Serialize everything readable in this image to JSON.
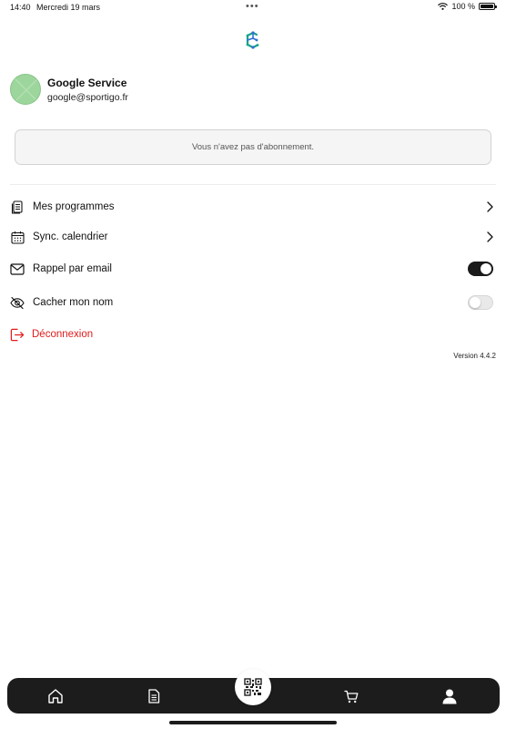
{
  "status_bar": {
    "time": "14:40",
    "date": "Mercredi 19 mars",
    "dots": "•••",
    "battery": "100 %",
    "icons": [
      "wifi-icon",
      "battery-icon"
    ]
  },
  "logo": {
    "icon": "app-logo-icon",
    "color": "#1aa38a"
  },
  "profile": {
    "name": "Google Service",
    "email": "google@sportigo.fr",
    "avatar_color": "#9dd69d"
  },
  "subscription": {
    "message": "Vous n'avez pas d'abonnement."
  },
  "menu": {
    "programmes": {
      "label": "Mes programmes",
      "icon": "document-list-icon"
    },
    "calendar": {
      "label": "Sync. calendrier",
      "icon": "calendar-icon"
    },
    "email_reminder": {
      "label": "Rappel par email",
      "icon": "mail-icon",
      "enabled": true
    },
    "hide_name": {
      "label": "Cacher mon nom",
      "icon": "eye-off-icon",
      "enabled": false
    },
    "logout": {
      "label": "Déconnexion",
      "icon": "logout-icon",
      "color": "#e11b1b"
    }
  },
  "version": "Version 4.4.2",
  "bottom_nav": {
    "items": [
      {
        "name": "home",
        "icon": "home-icon"
      },
      {
        "name": "documents",
        "icon": "document-icon"
      },
      {
        "name": "scan",
        "icon": "qr-code-icon"
      },
      {
        "name": "cart",
        "icon": "cart-icon"
      },
      {
        "name": "profile",
        "icon": "user-icon"
      }
    ],
    "active": "profile"
  }
}
